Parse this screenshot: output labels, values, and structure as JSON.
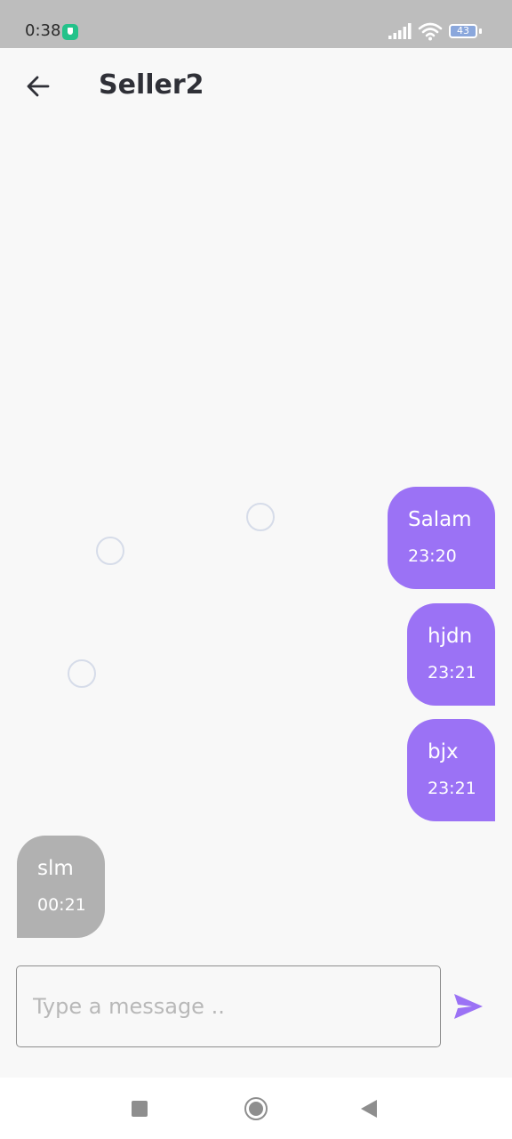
{
  "status_bar": {
    "time": "0:38",
    "battery": "43"
  },
  "header": {
    "title": "Seller2"
  },
  "messages": [
    {
      "text": "Salam",
      "time": "23:20",
      "direction": "outgoing"
    },
    {
      "text": "hjdn",
      "time": "23:21",
      "direction": "outgoing"
    },
    {
      "text": "bjx",
      "time": "23:21",
      "direction": "outgoing"
    },
    {
      "text": "slm",
      "time": "00:21",
      "direction": "incoming"
    }
  ],
  "composer": {
    "placeholder": "Type a message ..",
    "value": ""
  },
  "colors": {
    "outgoing_bubble": "#9b72f5",
    "incoming_bubble": "#b1b1b1",
    "accent": "#9b72f5"
  },
  "icons": {
    "back": "arrow-left-icon",
    "send": "send-icon",
    "shield": "shield-icon",
    "signal": "signal-icon",
    "wifi": "wifi-icon",
    "battery": "battery-icon"
  }
}
